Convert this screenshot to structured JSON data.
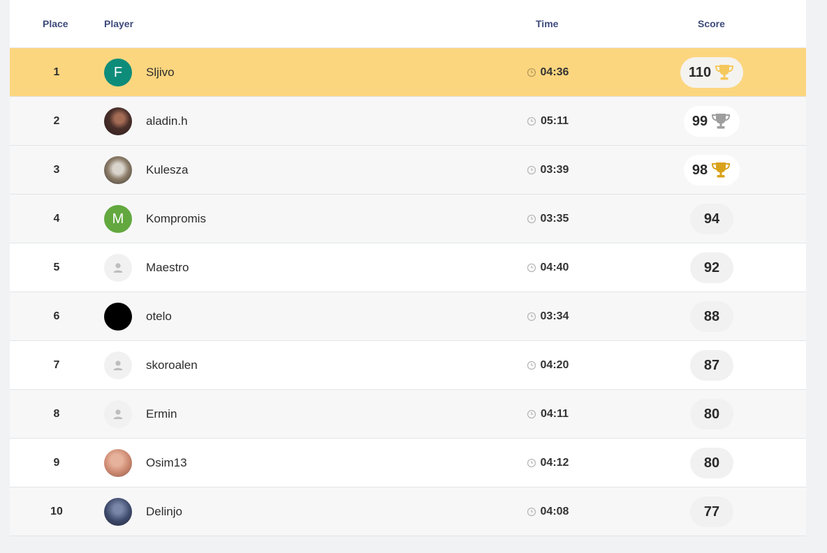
{
  "header": {
    "place": "Place",
    "player": "Player",
    "time": "Time",
    "score": "Score"
  },
  "rows": [
    {
      "place": "1",
      "name": "Sljivo",
      "time": "04:36",
      "score": "110",
      "avatar": "letter",
      "avatar_letter": "F",
      "avatar_color": "#0e8c7a",
      "trophy": "gold-light"
    },
    {
      "place": "2",
      "name": "aladin.h",
      "time": "05:11",
      "score": "99",
      "avatar": "photo",
      "trophy": "silver"
    },
    {
      "place": "3",
      "name": "Kulesza",
      "time": "03:39",
      "score": "98",
      "avatar": "photo",
      "trophy": "bronze"
    },
    {
      "place": "4",
      "name": "Kompromis",
      "time": "03:35",
      "score": "94",
      "avatar": "letter",
      "avatar_letter": "M",
      "avatar_color": "#62a83f"
    },
    {
      "place": "5",
      "name": "Maestro",
      "time": "04:40",
      "score": "92",
      "avatar": "default"
    },
    {
      "place": "6",
      "name": "otelo",
      "time": "03:34",
      "score": "88",
      "avatar": "black"
    },
    {
      "place": "7",
      "name": "skoroalen",
      "time": "04:20",
      "score": "87",
      "avatar": "default"
    },
    {
      "place": "8",
      "name": "Ermin",
      "time": "04:11",
      "score": "80",
      "avatar": "default"
    },
    {
      "place": "9",
      "name": "Osim13",
      "time": "04:12",
      "score": "80",
      "avatar": "photo"
    },
    {
      "place": "10",
      "name": "Delinjo",
      "time": "04:08",
      "score": "77",
      "avatar": "photo"
    }
  ],
  "colors": {
    "highlight_row": "#fcd67f",
    "header_text": "#3d4a7a",
    "trophy_gold_light": "#f5c85c",
    "trophy_silver": "#9e9e9e",
    "trophy_bronze": "#d9a21b"
  },
  "icons": {
    "clock": "clock-icon",
    "trophy": "trophy-icon",
    "default_avatar": "user-icon"
  }
}
